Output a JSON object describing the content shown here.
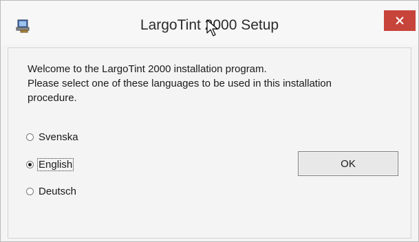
{
  "window": {
    "title": "LargoTint 2000 Setup",
    "close_icon": "close-icon",
    "app_icon": "setup-computer-icon"
  },
  "content": {
    "welcome_line1": "Welcome to the LargoTint 2000 installation program.",
    "welcome_line2": "Please select one of these languages to be used in this installation",
    "welcome_line3": "procedure."
  },
  "languages": {
    "selected": "English",
    "options": [
      "Svenska",
      "English",
      "Deutsch"
    ]
  },
  "buttons": {
    "ok_label": "OK"
  },
  "colors": {
    "close_button": "#c7443a",
    "window_background": "#f4f4f4"
  }
}
